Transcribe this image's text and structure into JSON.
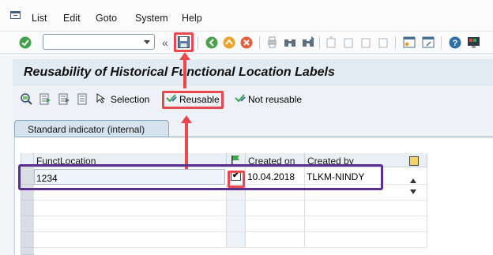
{
  "menu": {
    "items": [
      "List",
      "Edit",
      "Goto",
      "System",
      "Help"
    ]
  },
  "toolbar": {
    "command_field_value": "",
    "chevron": "«",
    "icons": [
      "check-icon",
      "save-icon",
      "back-icon",
      "exit-icon",
      "cancel-icon",
      "print-icon",
      "find-icon",
      "find-next-icon",
      "first-page-icon",
      "previous-page-icon",
      "next-page-icon",
      "last-page-icon",
      "create-session-icon",
      "shortcut-icon",
      "help-icon",
      "customize-layout-icon"
    ]
  },
  "title": "Reusability of Historical Functional Location Labels",
  "app_toolbar": {
    "selection_label": "Selection",
    "reusable_label": "Reusable",
    "not_reusable_label": "Not reusable"
  },
  "tab": {
    "label": "Standard indicator (internal)"
  },
  "table": {
    "columns": [
      "FunctLocation",
      "",
      "Created on",
      "Created by"
    ],
    "rows": [
      {
        "funct_location": "1234",
        "checked": "✔",
        "created_on": "10.04.2018",
        "created_by": "TLKM-NINDY"
      }
    ]
  },
  "colors": {
    "annotation_red": "#e8494f",
    "annotation_purple": "#5a2f8f",
    "title_bg": "#e3ebf2",
    "header_bg": "#eaeff4"
  }
}
